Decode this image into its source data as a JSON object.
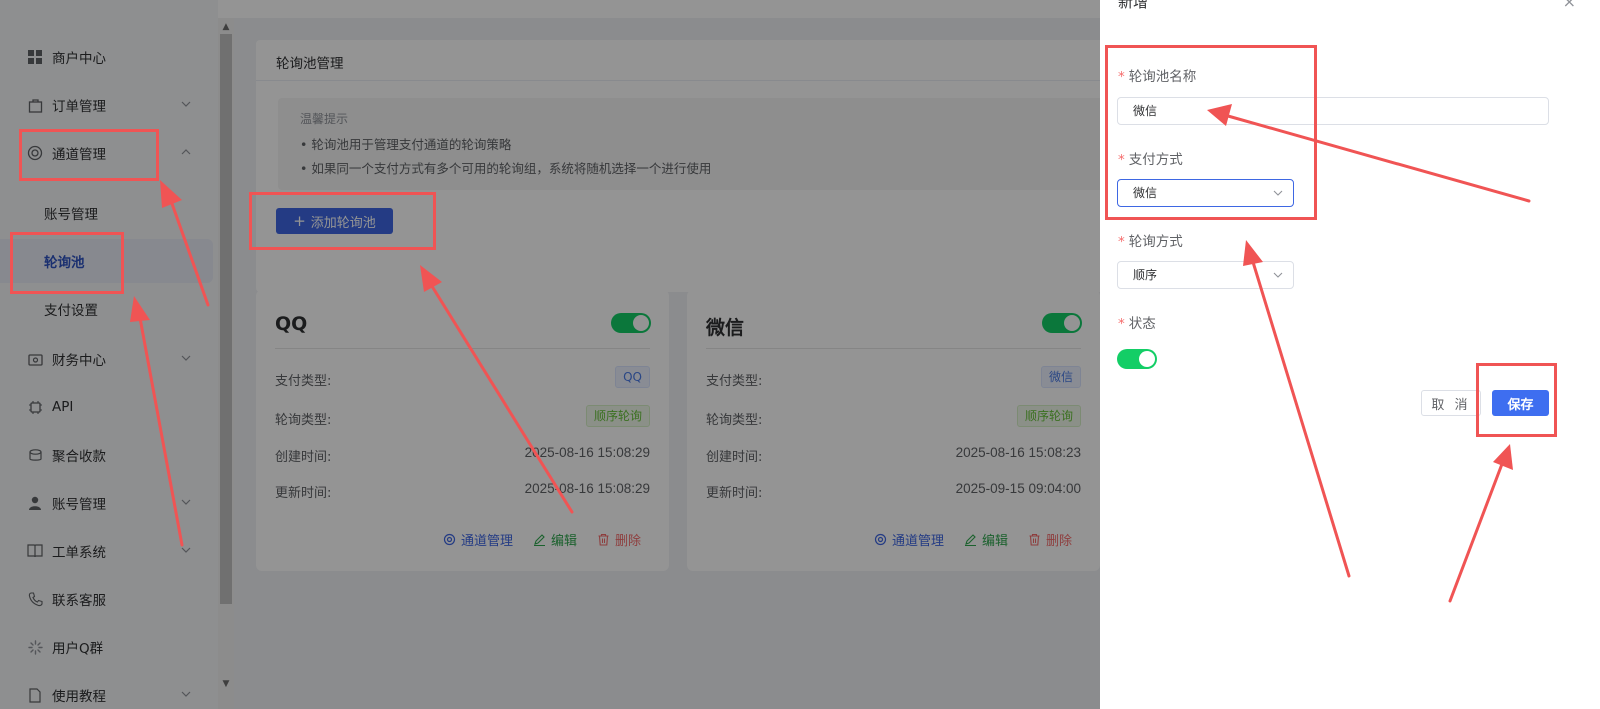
{
  "sidebar": {
    "items": [
      {
        "label": "商户中心",
        "icon": "grid-icon"
      },
      {
        "label": "订单管理",
        "icon": "bag-icon"
      },
      {
        "label": "通道管理",
        "icon": "channel-icon"
      },
      {
        "label": "财务中心",
        "icon": "wallet-icon"
      },
      {
        "label": "API",
        "icon": "chip-icon"
      },
      {
        "label": "聚合收款",
        "icon": "cash-icon"
      },
      {
        "label": "账号管理",
        "icon": "user-icon"
      },
      {
        "label": "工单系统",
        "icon": "book-icon"
      },
      {
        "label": "联系客服",
        "icon": "phone-icon"
      },
      {
        "label": "用户Q群",
        "icon": "loading-icon"
      },
      {
        "label": "使用教程",
        "icon": "doc-icon"
      }
    ],
    "sub_items": [
      {
        "label": "账号管理"
      },
      {
        "label": "轮询池"
      },
      {
        "label": "支付设置"
      }
    ]
  },
  "main": {
    "panel_title": "轮询池管理",
    "tip": {
      "title": "温馨提示",
      "lines": [
        "• 轮询池用于管理支付通道的轮询策略",
        "• 如果同一个支付方式有多个可用的轮询组，系统将随机选择一个进行使用"
      ]
    },
    "add_button": "添加轮询池",
    "cards": [
      {
        "title": "QQ",
        "enabled": true,
        "pay_type_label": "支付类型:",
        "pay_type_tag": "QQ",
        "poll_type_label": "轮询类型:",
        "poll_type_tag": "顺序轮询",
        "created_label": "创建时间:",
        "created_value": "2025-08-16 15:08:29",
        "updated_label": "更新时间:",
        "updated_value": "2025-08-16 15:08:29",
        "action_channel": "通道管理",
        "action_edit": "编辑",
        "action_delete": "删除"
      },
      {
        "title": "微信",
        "enabled": true,
        "pay_type_label": "支付类型:",
        "pay_type_tag": "微信",
        "poll_type_label": "轮询类型:",
        "poll_type_tag": "顺序轮询",
        "created_label": "创建时间:",
        "created_value": "2025-08-16 15:08:23",
        "updated_label": "更新时间:",
        "updated_value": "2025-09-15 09:04:00",
        "action_channel": "通道管理",
        "action_edit": "编辑",
        "action_delete": "删除"
      }
    ]
  },
  "drawer": {
    "title": "新增",
    "close": "×",
    "fields": {
      "name_label": "轮询池名称",
      "name_value": "微信",
      "pay_method_label": "支付方式",
      "pay_method_value": "微信",
      "poll_method_label": "轮询方式",
      "poll_method_value": "顺序",
      "status_label": "状态",
      "status_on": true
    },
    "required_mark": "*",
    "cancel": "取 消",
    "save": "保存"
  },
  "colors": {
    "primary": "#3e67e3",
    "annotation": "#f05454",
    "switch_on": "#13ce66",
    "danger": "#f56c6c"
  }
}
